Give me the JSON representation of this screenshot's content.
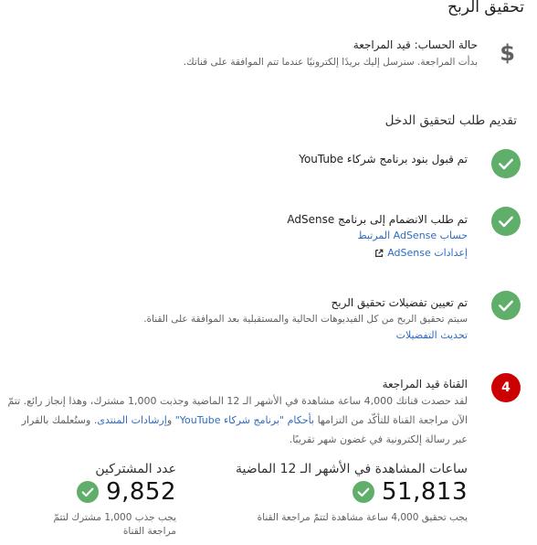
{
  "page": {
    "title": "تحقيق الربح"
  },
  "account_status": {
    "icon": "dollar-icon",
    "title": "حالة الحساب: قيد المراجعة",
    "description": "بدأت المراجعة. سنرسل إليك بريدًا إلكترونيًا عندما تتم الموافقة على قناتك."
  },
  "section": {
    "title": "تقديم طلب لتحقيق الدخل"
  },
  "steps": [
    {
      "icon": "check-icon",
      "title": "تم قبول بنود برنامج شركاء YouTube"
    },
    {
      "icon": "check-icon",
      "title": "تم طلب الانضمام إلى برنامج AdSense",
      "link1": "حساب AdSense المرتبط",
      "link2": "إعدادات AdSense"
    },
    {
      "icon": "check-icon",
      "title": "تم تعيين تفضيلات تحقيق الربح",
      "description": "سيتم تحقيق الربح من كل الفيديوهات الحالية والمستقبلية بعد الموافقة على القناة.",
      "link": "تحديث التفضيلات"
    },
    {
      "badge": "4",
      "title": "القناة قيد المراجعة",
      "para_part1": "لقد حصدت قناتك 4,000 ساعة مشاهدة في الأشهر الـ 12 الماضية وجذبت 1,000 مشترك، وهذا إنجاز رائع. تتمّ الآن مراجعة القناة للتأكّد من التزامها ",
      "para_link1": "بأحكام \"برنامج شركاء YouTube\"",
      "para_and": " و",
      "para_link2": "إرشادات المنتدى",
      "para_part2": ". وستُعلمك بالقرار عبر رسالة إلكترونية في غضون شهر تقريبًا."
    }
  ],
  "stats": {
    "watch_hours": {
      "label": "ساعات المشاهدة في الأشهر الـ 12 الماضية",
      "value": "51,813",
      "note": "يجب تحقيق 4,000 ساعة مشاهدة لتتمّ مراجعة القناة"
    },
    "subscribers": {
      "label": "عدد المشتركين",
      "value": "9,852",
      "note_line1": "يجب جذب 1,000 مشترك لتتمّ",
      "note_line2": "مراجعة القناة"
    }
  },
  "colors": {
    "check_green": "#5fae6a",
    "badge_red": "#cc0000",
    "link_blue": "#2e6bc4"
  }
}
